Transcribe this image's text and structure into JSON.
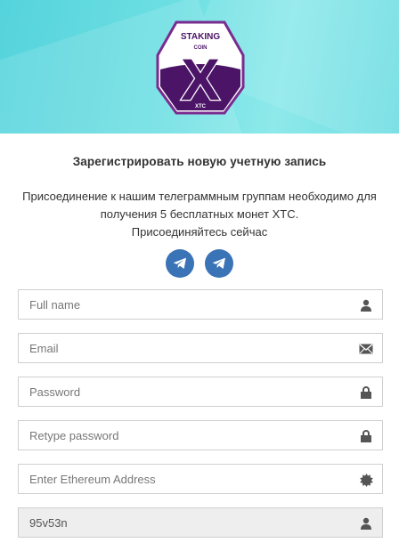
{
  "header": {
    "logo": {
      "top_text": "STAKING",
      "mid_text": "COIN",
      "big_letter": "X",
      "bottom_text": "XTC"
    },
    "colors": {
      "purple": "#4b1466",
      "violet_border": "#7a2b8f",
      "cyan": "#6fe0e3"
    }
  },
  "main": {
    "title": "Зарегистрировать новую учетную запись",
    "info_line1": "Присоединение к нашим телеграммным группам необходимо для",
    "info_line2": "получения 5 бесплатных монет XTC.",
    "info_line3": "Присоединяйтесь сейчас",
    "telegram_buttons": [
      {
        "icon": "telegram-icon"
      },
      {
        "icon": "telegram-icon"
      }
    ]
  },
  "form": {
    "fullname": {
      "placeholder": "Full name",
      "icon": "user-icon"
    },
    "email": {
      "placeholder": "Email",
      "icon": "envelope-icon"
    },
    "password": {
      "placeholder": "Password",
      "icon": "lock-icon"
    },
    "retype": {
      "placeholder": "Retype password",
      "icon": "lock-icon"
    },
    "ethereum": {
      "placeholder": "Enter Ethereum Address",
      "icon": "certificate-icon"
    },
    "referral": {
      "value": "95v53n",
      "icon": "user-icon"
    }
  }
}
